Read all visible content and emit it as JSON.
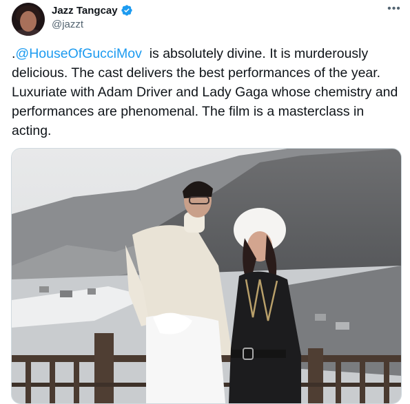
{
  "tweet": {
    "author": {
      "display_name": "Jazz Tangcay",
      "handle": "@jazzt",
      "verified": true
    },
    "text_prefix": ".",
    "mention": "@HouseOfGucciMov",
    "text_rest": "  is absolutely divine. It is murderously delicious. The cast delivers the best performances of the year. Luxuriate with Adam Driver and Lady Gaga whose chemistry and performances are phenomenal. The film is a masterclass in acting.",
    "more_label": "•••"
  },
  "colors": {
    "accent": "#1d9bf0",
    "secondary_text": "#536471",
    "primary_text": "#0f1419",
    "border": "#cfd9de"
  },
  "icons": {
    "verified": "verified-badge-icon",
    "more": "more-options-icon"
  }
}
